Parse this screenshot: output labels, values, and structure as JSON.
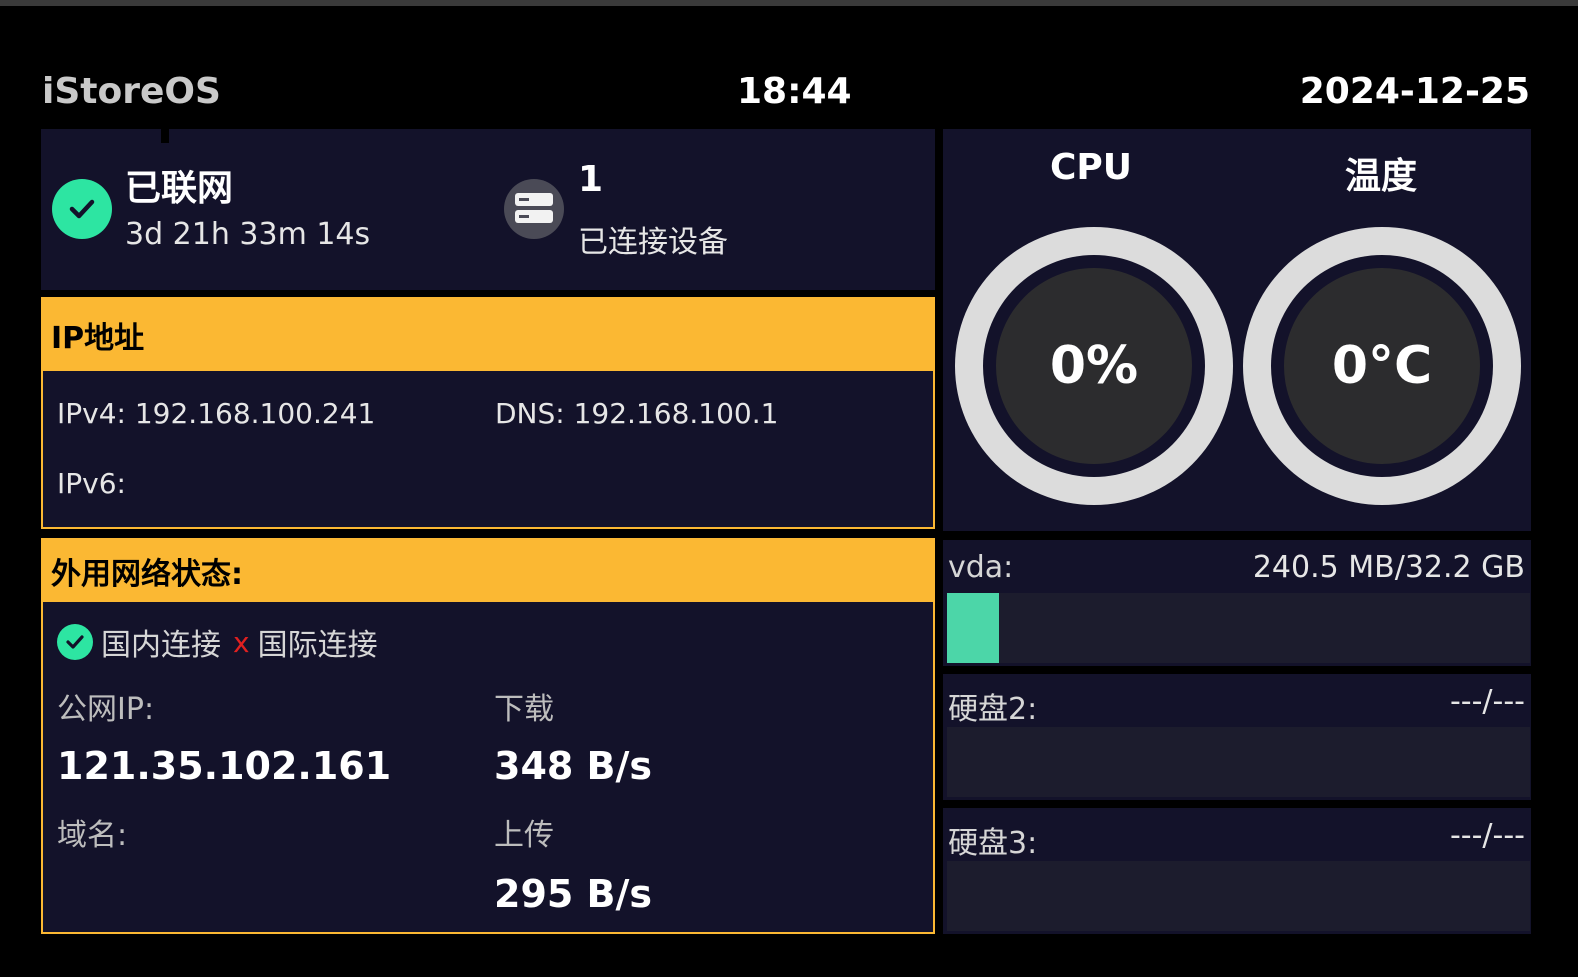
{
  "header": {
    "brand": "iStoreOS",
    "time": "18:44",
    "date": "2024-12-25"
  },
  "status": {
    "online_label": "已联网",
    "uptime": "3d 21h 33m 14s",
    "device_count": "1",
    "device_label": "已连接设备"
  },
  "ip": {
    "title": "IP地址",
    "ipv4": "IPv4: 192.168.100.241",
    "dns": "DNS: 192.168.100.1",
    "ipv6": "IPv6:"
  },
  "wan": {
    "title": "外用网络状态:",
    "domestic_label": "国内连接",
    "intl_mark": "x",
    "intl_label": "国际连接",
    "public_ip_label": "公网IP:",
    "public_ip": "121.35.102.161",
    "domain_label": "域名:",
    "download_label": "下载",
    "download": "348 B/s",
    "upload_label": "上传",
    "upload": "295 B/s"
  },
  "gauges": {
    "cpu_title": "CPU",
    "cpu_value": "0%",
    "temp_title": "温度",
    "temp_value": "0°C"
  },
  "disks": [
    {
      "name": "vda:",
      "usage": "240.5 MB/32.2 GB",
      "fill_fraction": 0.09
    },
    {
      "name": "硬盘2:",
      "usage": "---/---",
      "fill_fraction": 0
    },
    {
      "name": "硬盘3:",
      "usage": "---/---",
      "fill_fraction": 0
    }
  ],
  "colors": {
    "accent_yellow": "#fbb833",
    "success_green": "#2de5a2",
    "panel_bg": "#13122a",
    "disk_fill": "#4cd6a8",
    "error_red": "#e02020"
  }
}
